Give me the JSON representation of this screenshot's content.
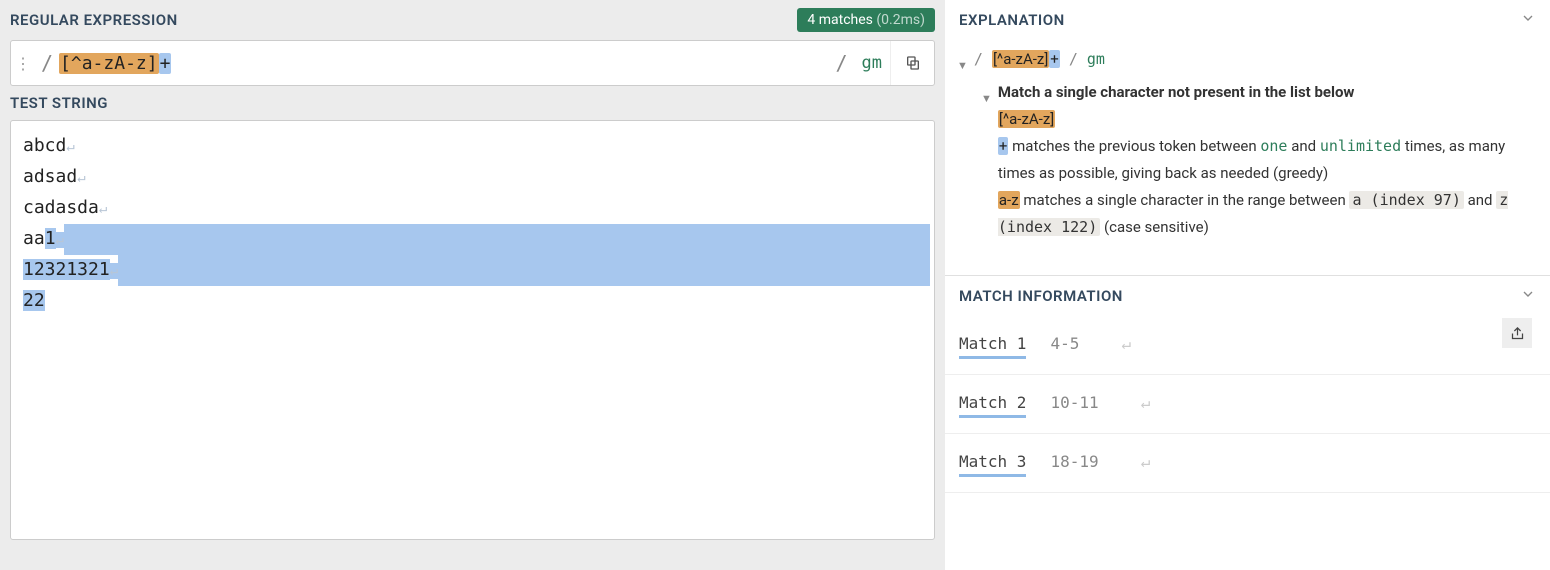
{
  "headers": {
    "regex": "REGULAR EXPRESSION",
    "testString": "TEST STRING",
    "explanation": "EXPLANATION",
    "matchInfo": "MATCH INFORMATION"
  },
  "status": {
    "count": "4 matches",
    "time": "(0.2ms)"
  },
  "regex": {
    "openDelim": "/",
    "charclass": "[^a-zA-z]",
    "quantifier": "+",
    "closeDelim": "/",
    "flags": "gm"
  },
  "test": {
    "lines": [
      {
        "pre": "abcd",
        "hl": "",
        "post": "",
        "endHl": false
      },
      {
        "pre": "adsad",
        "hl": "",
        "post": "",
        "endHl": false
      },
      {
        "pre": "cadasda",
        "hl": "",
        "post": "",
        "endHl": false
      },
      {
        "pre": "aa",
        "hl": "1",
        "post": "",
        "endHl": true
      },
      {
        "pre": "",
        "hl": "12321321",
        "post": "",
        "endHl": true
      },
      {
        "pre": "",
        "hl": "22",
        "post": "",
        "endHl": false
      }
    ]
  },
  "explain": {
    "titleLine": "Match a single character not present in the list below",
    "classBadge": "[^a-zA-z]",
    "quantBadge": "+",
    "quantText1": "matches the previous token between",
    "quantOne": "one",
    "quantAnd": "and",
    "quantUnl": "unlimited",
    "quantText2": "times, as many times as possible, giving back as needed (greedy)",
    "rangeBadge": "a-z",
    "rangeText1": "matches a single character in the range between",
    "rangeA": "a (index 97)",
    "rangeAnd": "and",
    "rangeZ": "z (index 122)",
    "rangeText2": "(case sensitive)"
  },
  "matches": [
    {
      "label": "Match 1",
      "range": "4-5"
    },
    {
      "label": "Match 2",
      "range": "10-11"
    },
    {
      "label": "Match 3",
      "range": "18-19"
    }
  ]
}
